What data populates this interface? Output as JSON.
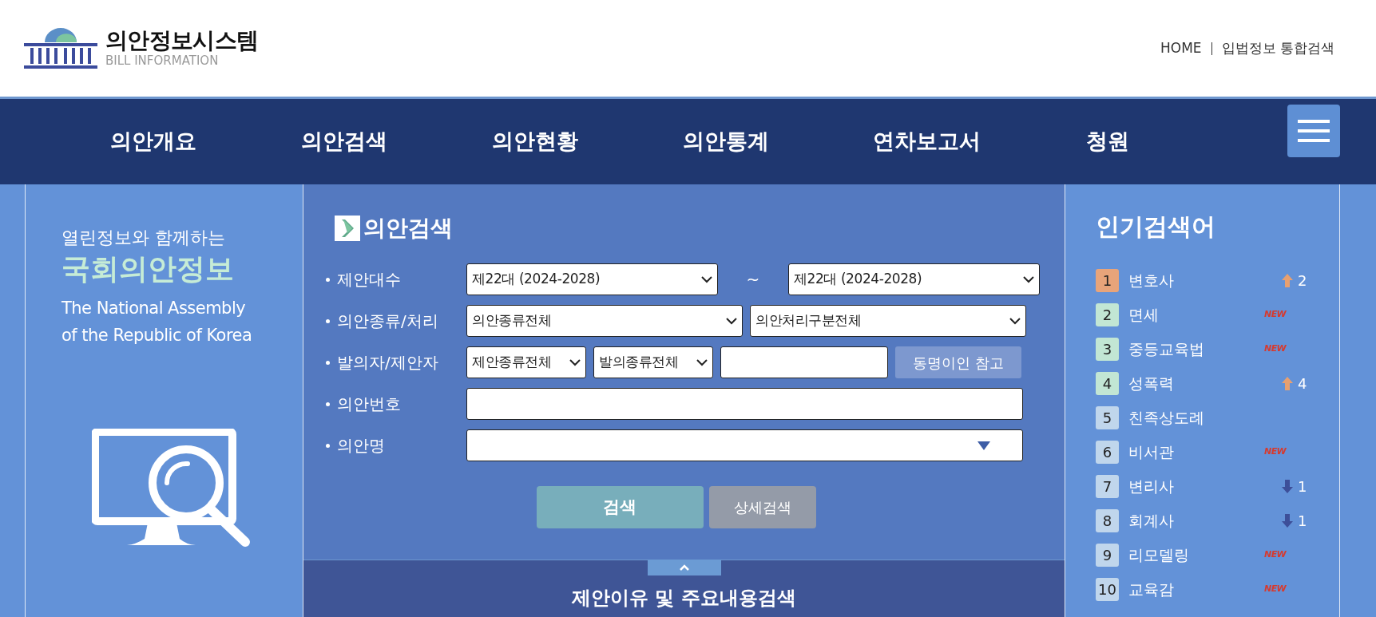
{
  "header": {
    "logo_title": "의안정보시스템",
    "logo_subtitle": "BILL INFORMATION",
    "links": [
      "HOME",
      "입법정보 통합검색"
    ]
  },
  "nav": {
    "items": [
      "의안개요",
      "의안검색",
      "의안현황",
      "의안통계",
      "연차보고서",
      "청원"
    ]
  },
  "intro": {
    "line_1": "열린정보와 함께하는",
    "line_2": "국회의안정보",
    "english": "The National Assembly of the Republic of Korea"
  },
  "search": {
    "title": "의안검색",
    "rows": [
      {
        "label": "제안대수",
        "controls": [
          {
            "kind": "select",
            "value": "제22대 (2024-2028)"
          },
          {
            "kind": "tilde",
            "value": "~"
          },
          {
            "kind": "select",
            "value": "제22대 (2024-2028)"
          }
        ]
      },
      {
        "label": "의안종류/처리",
        "controls": [
          {
            "kind": "select",
            "value": "의안종류전체"
          },
          {
            "kind": "select",
            "value": "의안처리구분전체"
          }
        ]
      },
      {
        "label": "발의자/제안자",
        "controls": [
          {
            "kind": "select",
            "value": "제안종류전체"
          },
          {
            "kind": "select",
            "value": "발의종류전체"
          },
          {
            "kind": "input"
          },
          {
            "kind": "button",
            "value": "동명이인 참고"
          }
        ]
      },
      {
        "label": "의안번호",
        "controls": [
          {
            "kind": "input"
          }
        ]
      },
      {
        "label": "의안명",
        "controls": [
          {
            "kind": "combo"
          }
        ]
      }
    ],
    "buttons": [
      {
        "label": "검색",
        "kind": "primary"
      },
      {
        "label": "상세검색",
        "kind": "secondary"
      }
    ],
    "reason_search": "제안이유 및 주요내용검색"
  },
  "popular": {
    "title": "인기검색어",
    "items": [
      {
        "rank": "1",
        "term": "변호사",
        "color": "#e8a47a",
        "kind": "up",
        "change": "2"
      },
      {
        "rank": "2",
        "term": "면세",
        "color": "#c2e6d4",
        "kind": "new",
        "change": "NEW"
      },
      {
        "rank": "3",
        "term": "중등교육법",
        "color": "#c2e6d4",
        "kind": "new",
        "change": "NEW"
      },
      {
        "rank": "4",
        "term": "성폭력",
        "color": "#c2e6d4",
        "kind": "up",
        "change": "4"
      },
      {
        "rank": "5",
        "term": "친족상도례",
        "color": "#c0d6ec",
        "kind": "plain"
      },
      {
        "rank": "6",
        "term": "비서관",
        "color": "#c0d6ec",
        "kind": "new",
        "change": "NEW"
      },
      {
        "rank": "7",
        "term": "변리사",
        "color": "#c0d6ec",
        "kind": "down",
        "change": "1"
      },
      {
        "rank": "8",
        "term": "회계사",
        "color": "#c0d6ec",
        "kind": "down",
        "change": "1"
      },
      {
        "rank": "9",
        "term": "리모델링",
        "color": "#c0d6ec",
        "kind": "new",
        "change": "NEW"
      },
      {
        "rank": "10",
        "term": "교육감",
        "color": "#c0d6ec",
        "kind": "new",
        "change": "NEW"
      }
    ]
  }
}
